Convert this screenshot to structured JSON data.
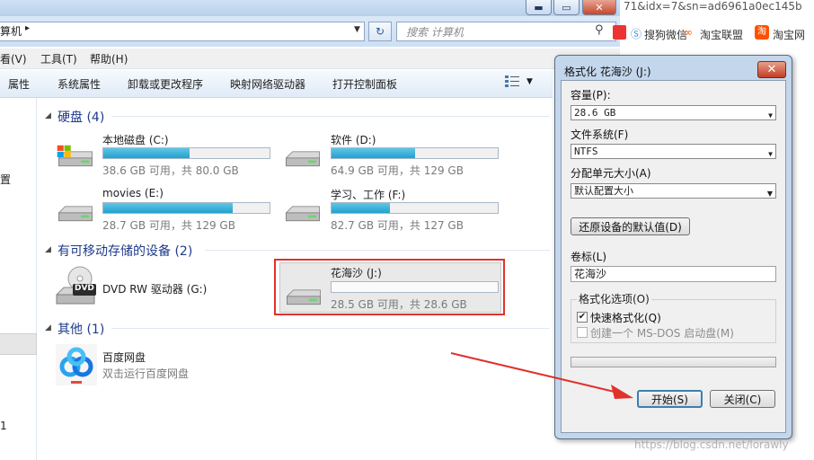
{
  "explorer": {
    "window_buttons": {
      "minimize": "▬",
      "maximize": "▭",
      "close": "✕"
    },
    "address": {
      "path": "算机",
      "chevron": "▸"
    },
    "search": {
      "placeholder": "搜索 计算机"
    },
    "menu": [
      "看(V)",
      "工具(T)",
      "帮助(H)"
    ],
    "toolbar": [
      "属性",
      "系统属性",
      "卸载或更改程序",
      "映射网络驱动器",
      "打开控制面板"
    ],
    "nav_fragments": [
      "置",
      "1"
    ],
    "sections": [
      {
        "title": "硬盘 (4)",
        "items": [
          {
            "name": "本地磁盘 (C:)",
            "info": "38.6 GB 可用，共 80.0 GB",
            "used_fraction": 0.52
          },
          {
            "name": "软件 (D:)",
            "info": "64.9 GB 可用，共 129 GB",
            "used_fraction": 0.5
          },
          {
            "name": "movies (E:)",
            "info": "28.7 GB 可用，共 129 GB",
            "used_fraction": 0.78
          },
          {
            "name": "学习、工作 (F:)",
            "info": "82.7 GB 可用，共 127 GB",
            "used_fraction": 0.35
          }
        ]
      },
      {
        "title": "有可移动存储的设备 (2)",
        "items": [
          {
            "name": "DVD RW 驱动器 (G:)",
            "badge": "DVD"
          },
          {
            "name": "花海沙 (J:)",
            "info": "28.5 GB 可用，共 28.6 GB",
            "used_fraction": 0.0
          }
        ]
      },
      {
        "title": "其他 (1)",
        "items": [
          {
            "name": "百度网盘",
            "info": "双击运行百度网盘"
          }
        ]
      }
    ]
  },
  "browser": {
    "url_fragment": "71&idx=7&sn=ad6961a0ec145b",
    "bookmarks": [
      "搜狗微信",
      "淘宝联盟",
      "淘宝网"
    ]
  },
  "dialog": {
    "title": "格式化 花海沙 (J:)",
    "close": "✕",
    "capacity_label": "容量(P):",
    "capacity_value": "28.6 GB",
    "filesystem_label": "文件系统(F)",
    "filesystem_value": "NTFS",
    "alloc_label": "分配单元大小(A)",
    "alloc_value": "默认配置大小",
    "restore_button": "还原设备的默认值(D)",
    "volume_label": "卷标(L)",
    "volume_value": "花海沙",
    "options_legend": "格式化选项(O)",
    "quick_format": "快速格式化(Q)",
    "quick_format_checked": true,
    "msdos": "创建一个 MS-DOS 启动盘(M)",
    "msdos_checked": false,
    "progress": 0,
    "start_button": "开始(S)",
    "close_button": "关闭(C)"
  },
  "watermark": "https://blog.csdn.net/lorawly",
  "colors": {
    "annotation_red": "#e0322d",
    "section_blue": "#1e3a8a",
    "bar_fill": "#23a0cf"
  }
}
